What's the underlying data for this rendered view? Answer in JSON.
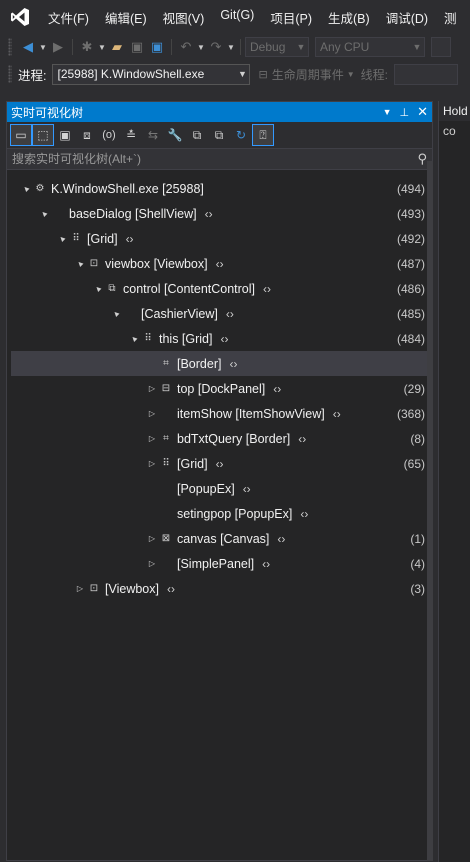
{
  "menu": {
    "items": [
      "文件(F)",
      "编辑(E)",
      "视图(V)",
      "Git(G)",
      "项目(P)",
      "生成(B)",
      "调试(D)",
      "测"
    ]
  },
  "toolbar": {
    "config": "Debug",
    "platform": "Any CPU"
  },
  "process": {
    "label": "进程:",
    "value": "[25988] K.WindowShell.exe",
    "lifecycle": "生命周期事件",
    "thread_label": "线程:"
  },
  "panel": {
    "title": "实时可视化树",
    "search_placeholder": "搜索实时可视化树(Alt+`)"
  },
  "tree": [
    {
      "indent": 0,
      "expander": "▲",
      "icon": "⚙",
      "label": "K.WindowShell.exe [25988]",
      "nav": false,
      "count": "(494)",
      "selected": false
    },
    {
      "indent": 1,
      "expander": "▲",
      "icon": "",
      "label": "baseDialog [ShellView]",
      "nav": true,
      "count": "(493)",
      "selected": false
    },
    {
      "indent": 2,
      "expander": "▲",
      "icon": "⠿",
      "label": "[Grid]",
      "nav": true,
      "count": "(492)",
      "selected": false
    },
    {
      "indent": 3,
      "expander": "▲",
      "icon": "⊡",
      "label": "viewbox [Viewbox]",
      "nav": true,
      "count": "(487)",
      "selected": false
    },
    {
      "indent": 4,
      "expander": "▲",
      "icon": "⧉",
      "label": "control [ContentControl]",
      "nav": true,
      "count": "(486)",
      "selected": false
    },
    {
      "indent": 5,
      "expander": "▲",
      "icon": "",
      "label": "[CashierView]",
      "nav": true,
      "count": "(485)",
      "selected": false
    },
    {
      "indent": 6,
      "expander": "▲",
      "icon": "⠿",
      "label": "this [Grid]",
      "nav": true,
      "count": "(484)",
      "selected": false
    },
    {
      "indent": 7,
      "expander": "",
      "icon": "⌗",
      "label": "[Border]",
      "nav": true,
      "count": "",
      "selected": true
    },
    {
      "indent": 7,
      "expander": "▷",
      "icon": "⊟",
      "label": "top [DockPanel]",
      "nav": true,
      "count": "(29)",
      "selected": false
    },
    {
      "indent": 7,
      "expander": "▷",
      "icon": "",
      "label": "itemShow [ItemShowView]",
      "nav": true,
      "count": "(368)",
      "selected": false
    },
    {
      "indent": 7,
      "expander": "▷",
      "icon": "⌗",
      "label": "bdTxtQuery [Border]",
      "nav": true,
      "count": "(8)",
      "selected": false
    },
    {
      "indent": 7,
      "expander": "▷",
      "icon": "⠿",
      "label": "[Grid]",
      "nav": true,
      "count": "(65)",
      "selected": false
    },
    {
      "indent": 7,
      "expander": "",
      "icon": "",
      "label": "[PopupEx]",
      "nav": true,
      "count": "",
      "selected": false
    },
    {
      "indent": 7,
      "expander": "",
      "icon": "",
      "label": "setingpop [PopupEx]",
      "nav": true,
      "count": "",
      "selected": false
    },
    {
      "indent": 7,
      "expander": "▷",
      "icon": "⊠",
      "label": "canvas [Canvas]",
      "nav": true,
      "count": "(1)",
      "selected": false
    },
    {
      "indent": 7,
      "expander": "▷",
      "icon": "",
      "label": "[SimplePanel]",
      "nav": true,
      "count": "(4)",
      "selected": false
    },
    {
      "indent": 3,
      "expander": "▷",
      "icon": "⊡",
      "label": "[Viewbox]",
      "nav": true,
      "count": "(3)",
      "selected": false
    }
  ],
  "right_panel": {
    "title": "Hold",
    "subtitle": "co"
  }
}
